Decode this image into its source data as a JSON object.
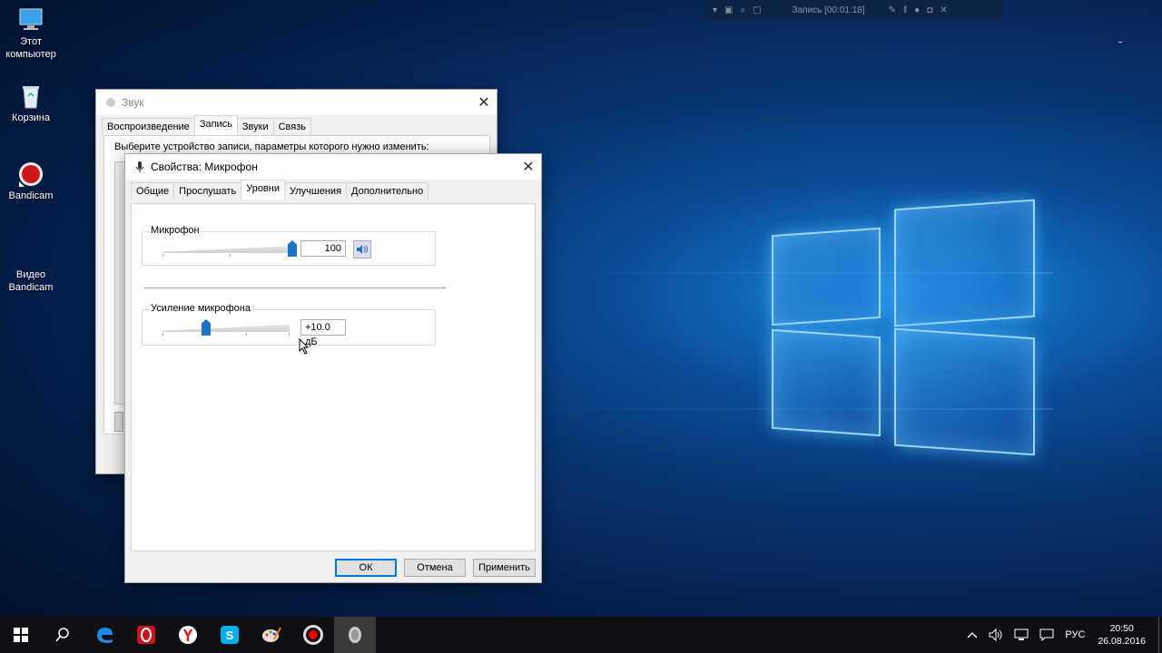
{
  "desktop": {
    "icons": [
      {
        "label_line1": "Этот",
        "label_line2": "компьютер",
        "icon": "computer-icon"
      },
      {
        "label_line1": "Корзина",
        "label_line2": "",
        "icon": "recycle-bin-icon"
      },
      {
        "label_line1": "Bandicam",
        "label_line2": "",
        "icon": "bandicam-icon"
      },
      {
        "label_line1": "Видео",
        "label_line2": "Bandicam",
        "icon": "folder-icon"
      }
    ]
  },
  "rec_overlay": {
    "title": "Запись [00:01:18]"
  },
  "sound_window": {
    "title": "Звук",
    "tabs": [
      "Воспроизведение",
      "Запись",
      "Звуки",
      "Связь"
    ],
    "active_tab": "Запись",
    "instruction": "Выберите устройство записи, параметры которого нужно изменить:"
  },
  "mic_props": {
    "title": "Свойства: Микрофон",
    "tabs": [
      "Общие",
      "Прослушать",
      "Уровни",
      "Улучшения",
      "Дополнительно"
    ],
    "active_tab": "Уровни",
    "mic_group": {
      "label": "Микрофон",
      "value": "100",
      "level_fraction": 1.0
    },
    "boost_group": {
      "label": "Усиление микрофона",
      "value": "+10.0 дБ",
      "level_fraction": 0.33
    },
    "buttons": {
      "ok": "ОК",
      "cancel": "Отмена",
      "apply": "Применить"
    }
  },
  "taskbar": {
    "items": [
      "start-icon",
      "search-icon",
      "edge-icon",
      "opera-icon",
      "yandex-icon",
      "skype-icon",
      "paint-icon",
      "bandicam-record-icon",
      "sound-app-icon"
    ],
    "tray": {
      "language": "РУС",
      "time": "20:50",
      "date": "26.08.2016"
    }
  },
  "colors": {
    "accent": "#0078d7",
    "slider_thumb": "#1a73c8"
  }
}
